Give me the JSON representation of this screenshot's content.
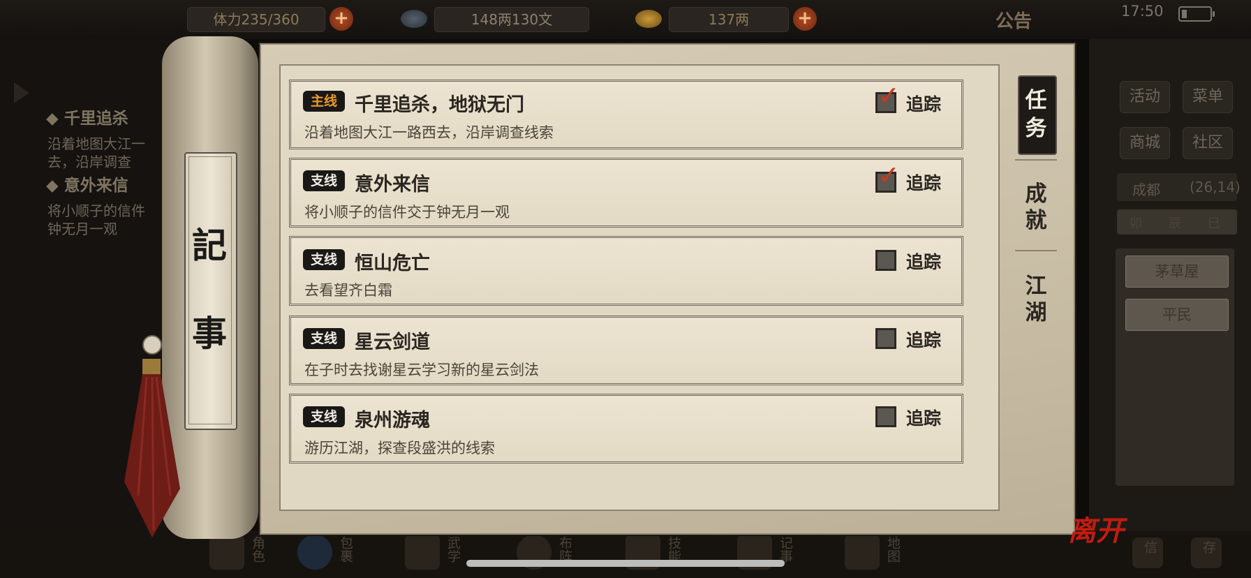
{
  "status_bar": {
    "time": "17:50"
  },
  "top_bar": {
    "stamina": "体力235/360",
    "silver": "148两130文",
    "gold": "137两",
    "notice": "公告"
  },
  "left_panel": {
    "items": [
      {
        "title": "◆ 千里追杀",
        "line1": "沿着地图大江一",
        "line2": "去，沿岸调查"
      },
      {
        "title": "◆ 意外来信",
        "line1": "将小顺子的信件",
        "line2": "钟无月一观"
      }
    ]
  },
  "right_panel": {
    "buttons": [
      "活动",
      "菜单",
      "商城",
      "社区"
    ],
    "location": "成都",
    "coords": "(26,14)",
    "time_row": [
      "卯",
      "辰",
      "巳"
    ],
    "list": [
      "茅草屋",
      "平民"
    ]
  },
  "scroll": {
    "plate_chars": [
      "記",
      "事"
    ],
    "quests": [
      {
        "tag": "主线",
        "kind": "main",
        "title": "千里追杀，地狱无门",
        "desc": "沿着地图大江一路西去，沿岸调查线索",
        "tracked": true,
        "track_label": "追踪"
      },
      {
        "tag": "支线",
        "kind": "side",
        "title": "意外来信",
        "desc": "将小顺子的信件交于钟无月一观",
        "tracked": true,
        "track_label": "追踪"
      },
      {
        "tag": "支线",
        "kind": "side",
        "title": "恒山危亡",
        "desc": "去看望齐白霜",
        "tracked": false,
        "track_label": "追踪"
      },
      {
        "tag": "支线",
        "kind": "side",
        "title": "星云剑道",
        "desc": "在子时去找谢星云学习新的星云剑法",
        "tracked": false,
        "track_label": "追踪"
      },
      {
        "tag": "支线",
        "kind": "side",
        "title": "泉州游魂",
        "desc": "游历江湖，探查段盛洪的线索",
        "tracked": false,
        "track_label": "追踪"
      }
    ],
    "tabs": [
      {
        "label1": "任",
        "label2": "务",
        "active": true
      },
      {
        "label1": "成",
        "label2": "就",
        "active": false
      },
      {
        "label1": "江",
        "label2": "湖",
        "active": false
      }
    ],
    "leave_label": "离开"
  },
  "bottom_bar": {
    "items": [
      "角色",
      "包裹",
      "武学",
      "布阵",
      "技能",
      "记事",
      "地图",
      "信",
      "存"
    ]
  }
}
